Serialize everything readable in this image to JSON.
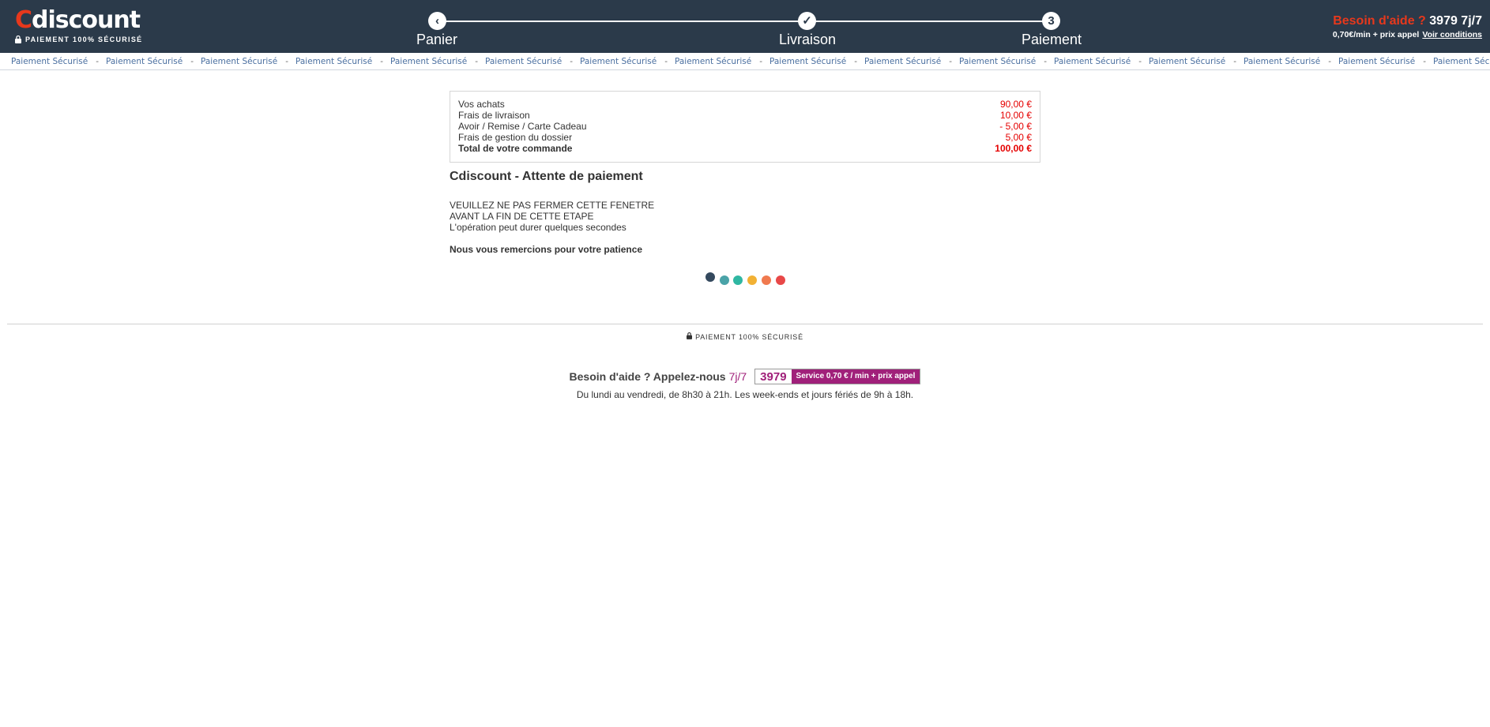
{
  "header": {
    "logo_word": "discount",
    "logo_letter": "C",
    "logo_tagline": "PAIEMENT 100% SÉCURISÉ",
    "steps": [
      {
        "label": "Panier",
        "icon": "chevron-left-icon",
        "glyph": "‹"
      },
      {
        "label": "Livraison",
        "icon": "check-icon",
        "glyph": "✓"
      },
      {
        "label": "Paiement",
        "icon": "step-number",
        "glyph": "3"
      }
    ],
    "help": {
      "question": "Besoin d'aide ?",
      "number": "3979 7j/7",
      "price": "0,70€/min + prix appel",
      "conditions": "Voir conditions"
    }
  },
  "ticker": {
    "text": "Paiement Sécurisé",
    "separator": "-"
  },
  "summary": {
    "rows": [
      {
        "label": "Vos achats",
        "amount": "90,00 €"
      },
      {
        "label": "Frais de livraison",
        "amount": "10,00 €"
      },
      {
        "label": "Avoir / Remise / Carte Cadeau",
        "amount": "- 5,00 €"
      },
      {
        "label": "Frais de gestion du dossier",
        "amount": "5,00 €"
      },
      {
        "label": "Total de votre commande",
        "amount": "100,00 €"
      }
    ]
  },
  "payment": {
    "title": "Cdiscount - Attente de paiement",
    "warning_lines": [
      "VEUILLEZ NE PAS FERMER CETTE FENETRE",
      "AVANT LA FIN DE CETTE ETAPE",
      "L'opération peut durer quelques secondes"
    ],
    "thanks": "Nous vous remercions pour votre patience",
    "dot_colors": [
      "#34495e",
      "#4aa3a8",
      "#2fb7a2",
      "#f2b134",
      "#f07a4f",
      "#e84848"
    ]
  },
  "footer": {
    "secure": "PAIEMENT 100% SÉCURISÉ",
    "call_text": "Besoin d'aide ? Appelez-nous",
    "call_days": "7j/7",
    "badge_number": "3979",
    "badge_service": "Service  0,70 € / min  + prix appel",
    "hours": "Du lundi au vendredi, de 8h30 à 21h. Les week-ends et jours fériés de 9h à 18h."
  },
  "colors": {
    "header_bg": "#2b3a4a",
    "brand_red": "#e7381c",
    "amount_red": "#e50000",
    "service_purple": "#a0207a",
    "ticker_blue": "#4a6fa0"
  }
}
